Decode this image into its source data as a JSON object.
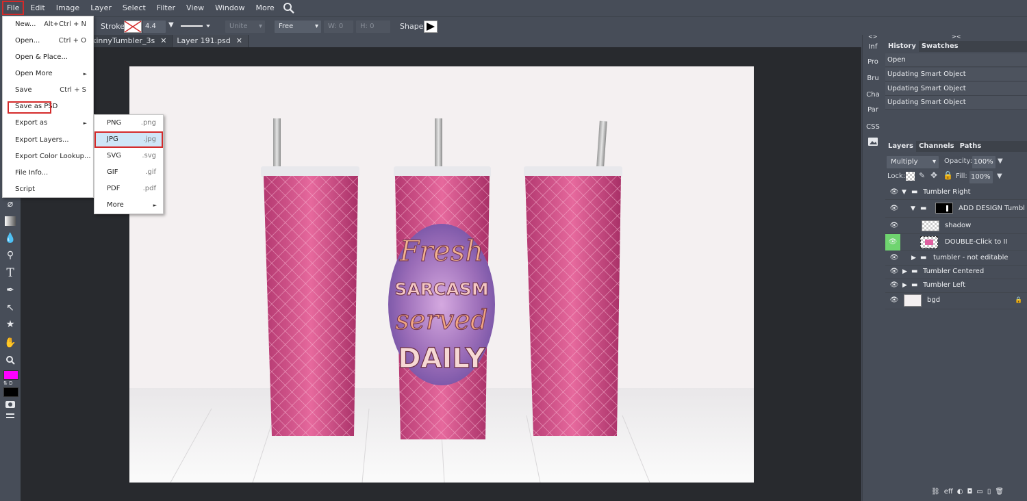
{
  "menubar": {
    "items": [
      "File",
      "Edit",
      "Image",
      "Layer",
      "Select",
      "Filter",
      "View",
      "Window",
      "More"
    ]
  },
  "options": {
    "stroke_label": "Stroke:",
    "stroke_width": "4.4 pt",
    "combine_mode": "Unite",
    "style_mode": "Free",
    "w_label": "W:",
    "w_value": "0",
    "h_label": "H:",
    "h_value": "0",
    "shape_label": "Shape:"
  },
  "tabs": [
    {
      "label": "kinnyTumbler_3s",
      "close": "✕"
    },
    {
      "label": "Layer 191.psd",
      "close": "✕"
    }
  ],
  "file_menu": {
    "items": [
      {
        "label": "New...",
        "shortcut": "Alt+Ctrl + N"
      },
      {
        "label": "Open...",
        "shortcut": "Ctrl + O"
      },
      {
        "label": "Open & Place...",
        "shortcut": ""
      },
      {
        "label": "Open More",
        "shortcut": "",
        "arrow": "►"
      },
      {
        "label": "Save",
        "shortcut": "Ctrl + S"
      },
      {
        "label": "Save as PSD",
        "shortcut": ""
      },
      {
        "label": "Export as",
        "shortcut": "",
        "arrow": "►"
      },
      {
        "label": "Export Layers...",
        "shortcut": ""
      },
      {
        "label": "Export Color Lookup...",
        "shortcut": ""
      },
      {
        "label": "File Info...",
        "shortcut": ""
      },
      {
        "label": "Script",
        "shortcut": ""
      }
    ]
  },
  "export_menu": {
    "items": [
      {
        "label": "PNG",
        "ext": ".png"
      },
      {
        "label": "JPG",
        "ext": ".jpg"
      },
      {
        "label": "SVG",
        "ext": ".svg"
      },
      {
        "label": "GIF",
        "ext": ".gif"
      },
      {
        "label": "PDF",
        "ext": ".pdf"
      },
      {
        "label": "More",
        "ext": "",
        "arrow": "►"
      }
    ]
  },
  "mini_panel": [
    "Inf",
    "Pro",
    "Bru",
    "Cha",
    "Par",
    "CSS"
  ],
  "history_panel": {
    "tabs": [
      "History",
      "Swatches"
    ],
    "items": [
      "Open",
      "Updating Smart Object",
      "Updating Smart Object",
      "Updating Smart Object"
    ]
  },
  "layers_panel": {
    "tabs": [
      "Layers",
      "Channels",
      "Paths"
    ],
    "blend_mode": "Multiply",
    "opacity_label": "Opacity:",
    "opacity": "100%",
    "lock_label": "Lock:",
    "fill_label": "Fill:",
    "fill": "100%",
    "layers": [
      {
        "name": "Tumbler Right",
        "indent": 0,
        "type": "folder",
        "expanded": true
      },
      {
        "name": "ADD DESIGN Tumbl",
        "indent": 1,
        "type": "folder-mask",
        "expanded": true
      },
      {
        "name": "shadow",
        "indent": 2,
        "type": "layer"
      },
      {
        "name": "DOUBLE-Click to II",
        "indent": 2,
        "type": "smart"
      },
      {
        "name": "tumbler - not editable",
        "indent": 1,
        "type": "folder",
        "expanded": false
      },
      {
        "name": "Tumbler Centered",
        "indent": 0,
        "type": "folder",
        "expanded": false
      },
      {
        "name": "Tumbler Left",
        "indent": 0,
        "type": "folder",
        "expanded": false
      },
      {
        "name": "bgd",
        "indent": 0,
        "type": "bg"
      }
    ]
  },
  "canvas_art": {
    "line1": "Fresh",
    "line2": "SARCASM",
    "line3": "served",
    "line4": "DAILY"
  },
  "colors": {
    "foreground": "#ff00ff",
    "background": "#000000",
    "highlight": "#d42a2a",
    "selected_item": "#cfe6f7"
  }
}
